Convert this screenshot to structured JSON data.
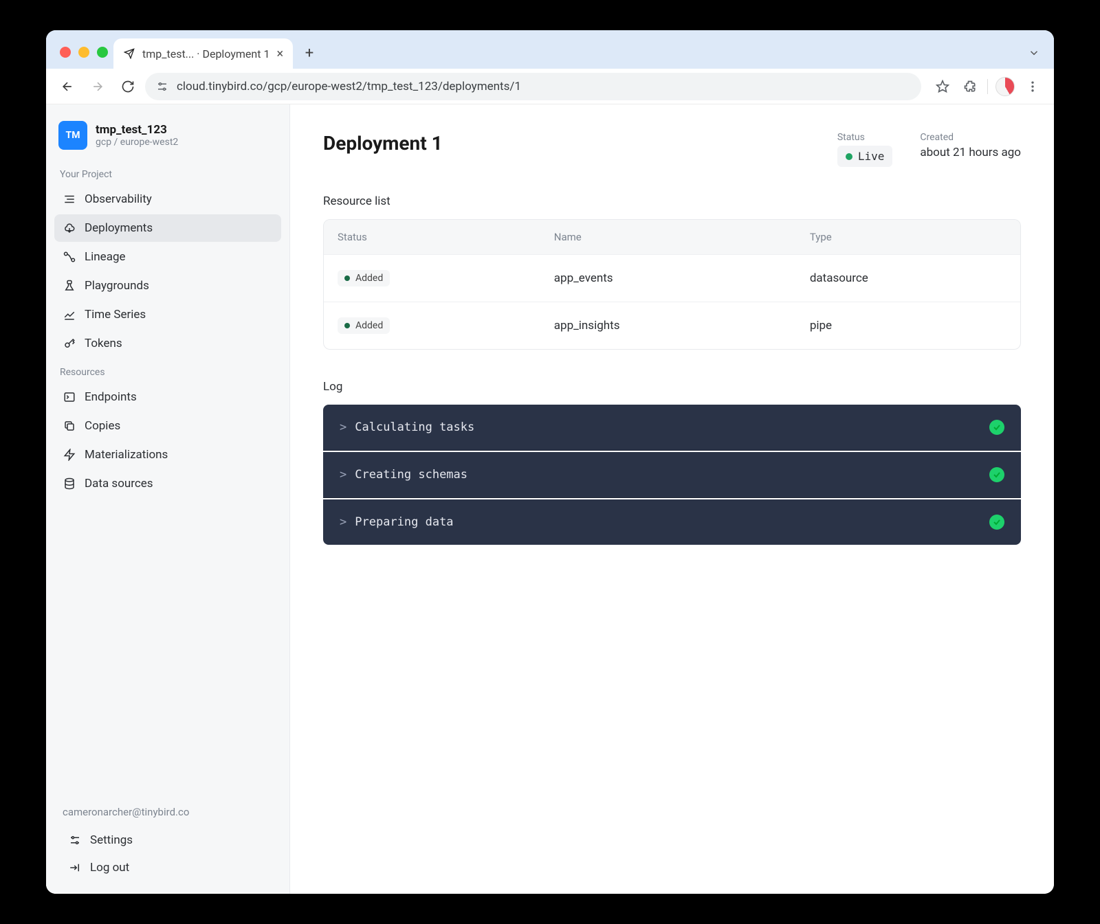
{
  "browser": {
    "tab_title": "tmp_test... · Deployment 1",
    "url": "cloud.tinybird.co/gcp/europe-west2/tmp_test_123/deployments/1"
  },
  "workspace": {
    "logo_text": "TM",
    "name": "tmp_test_123",
    "region": "gcp / europe-west2"
  },
  "nav": {
    "section_project": "Your Project",
    "section_resources": "Resources",
    "project_items": [
      {
        "label": "Observability"
      },
      {
        "label": "Deployments"
      },
      {
        "label": "Lineage"
      },
      {
        "label": "Playgrounds"
      },
      {
        "label": "Time Series"
      },
      {
        "label": "Tokens"
      }
    ],
    "resource_items": [
      {
        "label": "Endpoints"
      },
      {
        "label": "Copies"
      },
      {
        "label": "Materializations"
      },
      {
        "label": "Data sources"
      }
    ],
    "settings": "Settings",
    "logout": "Log out"
  },
  "user": {
    "email": "cameronarcher@tinybird.co"
  },
  "page": {
    "title": "Deployment 1",
    "status_label": "Status",
    "status_value": "Live",
    "created_label": "Created",
    "created_value": "about 21 hours ago"
  },
  "resource_list": {
    "title": "Resource list",
    "columns": {
      "status": "Status",
      "name": "Name",
      "type": "Type"
    },
    "rows": [
      {
        "status": "Added",
        "name": "app_events",
        "type": "datasource"
      },
      {
        "status": "Added",
        "name": "app_insights",
        "type": "pipe"
      }
    ]
  },
  "log": {
    "title": "Log",
    "rows": [
      {
        "text": "Calculating tasks",
        "ok": true
      },
      {
        "text": "Creating schemas",
        "ok": true
      },
      {
        "text": "Preparing data",
        "ok": true
      }
    ]
  }
}
